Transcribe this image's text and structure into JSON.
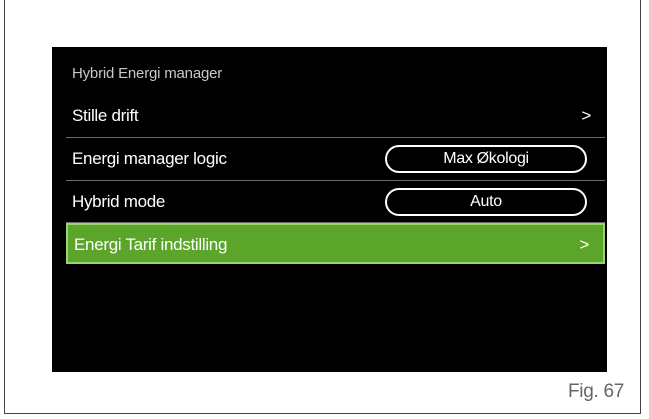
{
  "screen": {
    "title": "Hybrid Energi manager"
  },
  "menu": {
    "items": [
      {
        "label": "Stille drift",
        "arrow": ">"
      },
      {
        "label": "Energi manager logic",
        "value": "Max Økologi"
      },
      {
        "label": "Hybrid mode",
        "value": "Auto"
      },
      {
        "label": "Energi Tarif indstilling",
        "arrow": ">",
        "selected": true
      }
    ]
  },
  "figure": {
    "caption": "Fig. 67"
  },
  "colors": {
    "screen_background": "#000000",
    "selected_row": "#5aa52a",
    "selected_row_border": "#9cd36a",
    "text": "#ffffff"
  }
}
